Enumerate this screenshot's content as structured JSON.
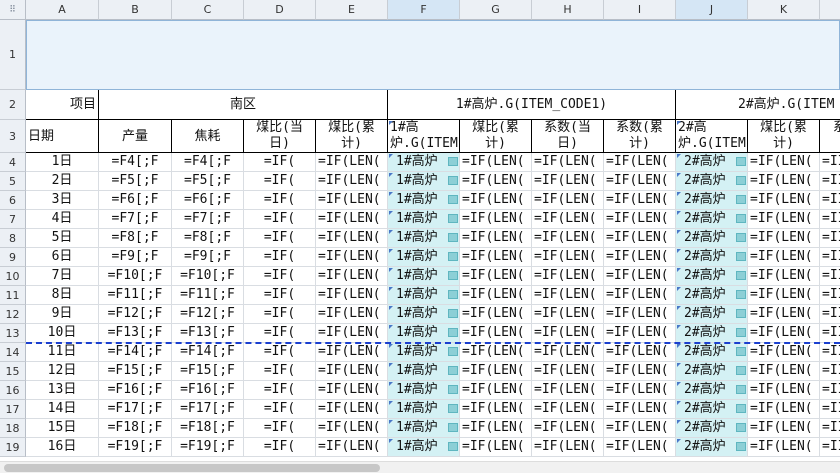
{
  "columns": [
    "A",
    "B",
    "C",
    "D",
    "E",
    "F",
    "G",
    "H",
    "I",
    "J",
    "K",
    ""
  ],
  "row_numbers": [
    "1",
    "2",
    "3",
    "4",
    "5",
    "6",
    "7",
    "8",
    "9",
    "10",
    "11",
    "12",
    "13",
    "14",
    "15",
    "16",
    "17",
    "18",
    "19"
  ],
  "header_row2": {
    "item": "项目",
    "south": "南区",
    "bf1": "1#高炉.G(ITEM_CODE1)",
    "bf2": "2#高炉.G(ITEM"
  },
  "header_row3": [
    "日期",
    "产量",
    "焦耗",
    "煤比(当日)",
    "煤比(累计)",
    "1#高炉.G(ITEM",
    "煤比(累计)",
    "系数(当日)",
    "系数(累计)",
    "2#高炉.G(ITEM",
    "煤比(累计)",
    "系"
  ],
  "dates": [
    "1日",
    "2日",
    "3日",
    "4日",
    "5日",
    "6日",
    "7日",
    "8日",
    "9日",
    "10日",
    "11日",
    "12日",
    "13日",
    "14日",
    "15日",
    "16日"
  ],
  "col_b": [
    "=F4[;F",
    "=F5[;F",
    "=F6[;F",
    "=F7[;F",
    "=F8[;F",
    "=F9[;F",
    "=F10[;F",
    "=F11[;F",
    "=F12[;F",
    "=F13[;F",
    "=F14[;F",
    "=F15[;F",
    "=F16[;F",
    "=F17[;F",
    "=F18[;F",
    "=F19[;F"
  ],
  "col_c": [
    "=F4[;F",
    "=F5[;F",
    "=F6[;F",
    "=F7[;F",
    "=F8[;F",
    "=F9[;F",
    "=F10[;F",
    "=F11[;F",
    "=F12[;F",
    "=F13[;F",
    "=F14[;F",
    "=F15[;F",
    "=F16[;F",
    "=F17[;F",
    "=F18[;F",
    "=F19[;F"
  ],
  "formula_if": "=IF(",
  "formula_iflen": "=IF(LEN(",
  "formula_il": "=II",
  "bf1_cell": "1#高炉",
  "bf2_cell": "2#高炉",
  "colors": {
    "header_bg": "#ecf0f5",
    "bf_highlight": "#d4f1f4",
    "page_break": "#1a3fcf"
  }
}
